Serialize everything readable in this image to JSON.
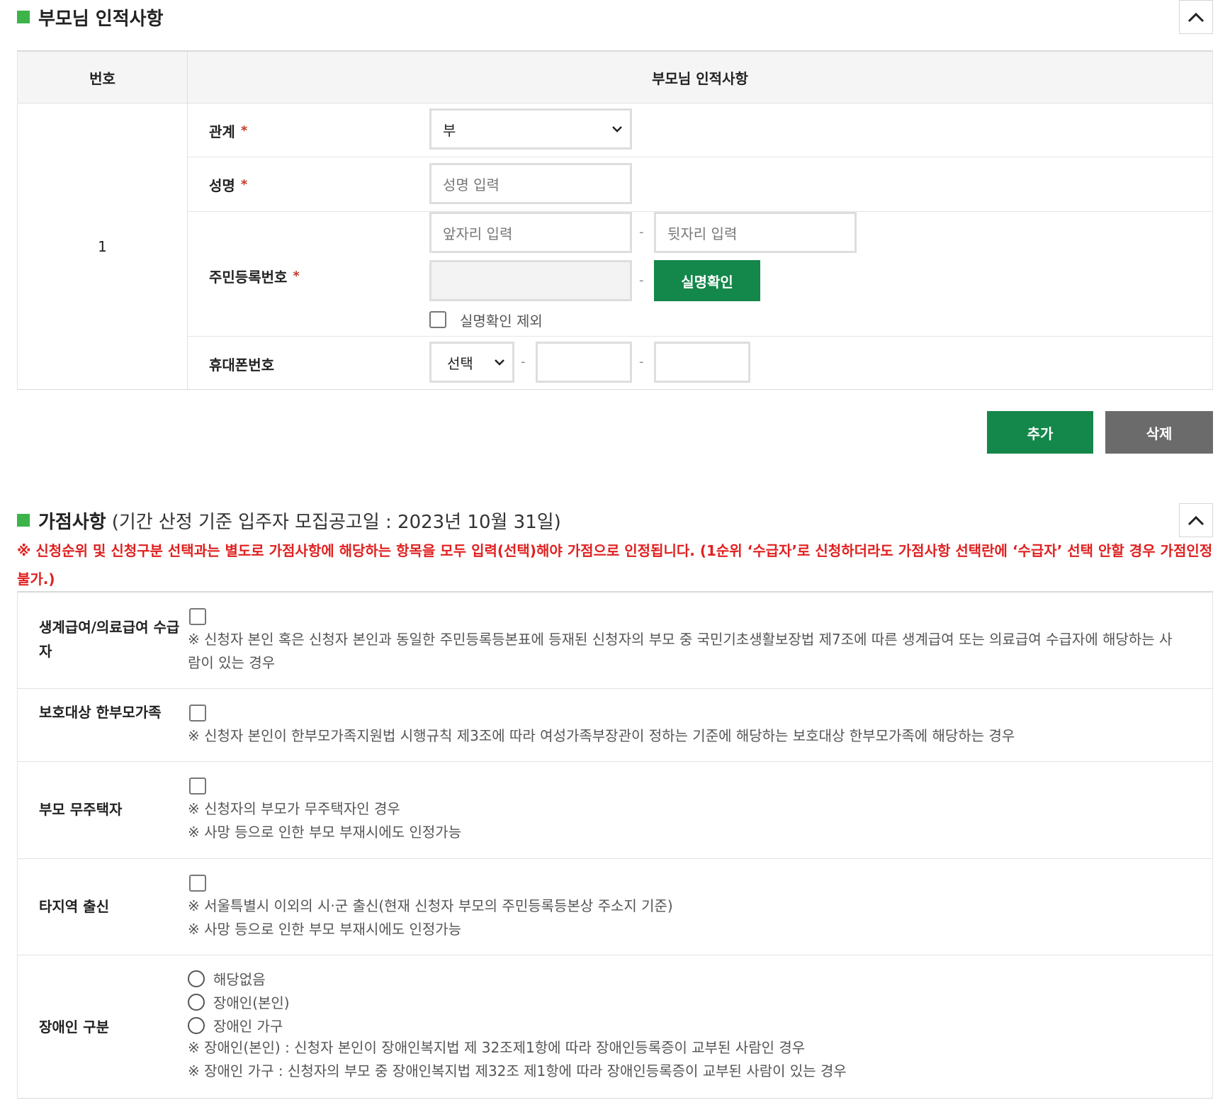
{
  "parent_section": {
    "title": "부모님 인적사항",
    "table": {
      "col_no": "번호",
      "col_info": "부모님 인적사항",
      "row_number": "1",
      "relation": {
        "label": "관계",
        "required_mark": "*",
        "value": "부"
      },
      "name": {
        "label": "성명",
        "required_mark": "*",
        "placeholder": "성명 입력"
      },
      "rrn": {
        "label": "주민등록번호",
        "required_mark": "*",
        "front_placeholder": "앞자리 입력",
        "back_placeholder": "뒷자리 입력",
        "dash": "-",
        "verify_button": "실명확인",
        "exclude_checkbox": "실명확인 제외"
      },
      "phone": {
        "label": "휴대폰번호",
        "select_value": "선택",
        "dash": "-"
      }
    },
    "add_button": "추가",
    "delete_button": "삭제"
  },
  "bonus_section": {
    "title": "가점사항",
    "subtitle": "(기간 산정 기준 입주자 모집공고일 : 2023년 10월 31일)",
    "notice": "※ 신청순위 및 신청구분 선택과는 별도로 가점사항에 해당하는 항목을 모두 입력(선택)해야 가점으로 인정됩니다. (1순위 ‘수급자’로 신청하더라도 가점사항 선택란에 ‘수급자’ 선택 안할 경우 가점인정 불가.)",
    "rows": [
      {
        "label": "생계급여/의료급여 수급자",
        "desc": [
          "※ 신청자 본인 혹은 신청자 본인과 동일한 주민등록등본표에 등재된 신청자의 부모 중 국민기초생활보장법 제7조에 따른 생계급여 또는 의료급여 수급자에 해당하는 사람이 있는 경우"
        ]
      },
      {
        "label": "보호대상 한부모가족",
        "desc": [
          "※ 신청자 본인이 한부모가족지원법 시행규칙 제3조에 따라 여성가족부장관이 정하는 기준에 해당하는 보호대상 한부모가족에 해당하는 경우"
        ]
      },
      {
        "label": "부모 무주택자",
        "desc": [
          "※ 신청자의 부모가 무주택자인 경우",
          "※ 사망 등으로 인한 부모 부재시에도 인정가능"
        ]
      },
      {
        "label": "타지역 출신",
        "desc": [
          "※ 서울특별시 이외의 시·군 출신(현재 신청자 부모의 주민등록등본상 주소지 기준)",
          "※ 사망 등으로 인한 부모 부재시에도 인정가능"
        ]
      },
      {
        "label": "장애인 구분",
        "options": [
          "해당없음",
          "장애인(본인)",
          "장애인 가구"
        ],
        "desc": [
          "※ 장애인(본인) : 신청자 본인이 장애인복지법 제 32조제1항에 따라 장애인등록증이 교부된 사람인 경우",
          "※ 장애인 가구 : 신청자의 부모 중 장애인복지법 제32조 제1항에 따라 장애인등록증이 교부된 사람이 있는 경우"
        ]
      }
    ]
  },
  "colors": {
    "accent_green": "#14874a",
    "section_marker": "#3cb44a",
    "notice_red": "#e02020",
    "delete_gray": "#6b6b6b"
  }
}
